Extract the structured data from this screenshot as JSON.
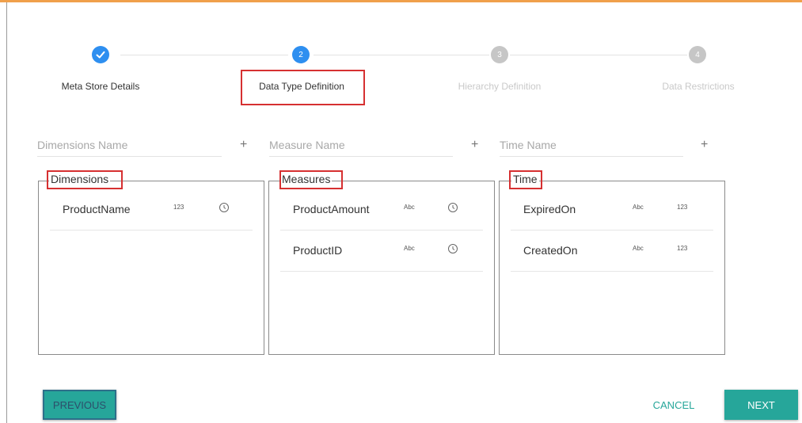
{
  "stepper": {
    "steps": [
      {
        "number": "✓",
        "label": "Meta Store Details"
      },
      {
        "number": "2",
        "label": "Data Type Definition"
      },
      {
        "number": "3",
        "label": "Hierarchy Definition"
      },
      {
        "number": "4",
        "label": "Data Restrictions"
      }
    ]
  },
  "inputs": {
    "dimensions_placeholder": "Dimensions Name",
    "measures_placeholder": "Measure Name",
    "time_placeholder": "Time Name",
    "add_symbol": "+"
  },
  "panels": {
    "dimensions": {
      "title": "Dimensions",
      "rows": [
        {
          "name": "ProductName",
          "badge": "123"
        }
      ]
    },
    "measures": {
      "title": "Measures",
      "rows": [
        {
          "name": "ProductAmount",
          "badge": "Abc"
        },
        {
          "name": "ProductID",
          "badge": "Abc"
        }
      ]
    },
    "time": {
      "title": "Time",
      "rows": [
        {
          "name": "ExpiredOn",
          "badge1": "Abc",
          "badge2": "123"
        },
        {
          "name": "CreatedOn",
          "badge1": "Abc",
          "badge2": "123"
        }
      ]
    }
  },
  "buttons": {
    "previous": "PREVIOUS",
    "cancel": "CANCEL",
    "next": "NEXT"
  },
  "icons": {
    "clock": "clock-icon",
    "check": "check-icon"
  },
  "colors": {
    "accent_teal": "#26a69a",
    "step_active": "#2e8ff0",
    "step_inactive": "#c6c6c6",
    "highlight_red": "#d63031",
    "top_bar": "#f0a04b"
  }
}
